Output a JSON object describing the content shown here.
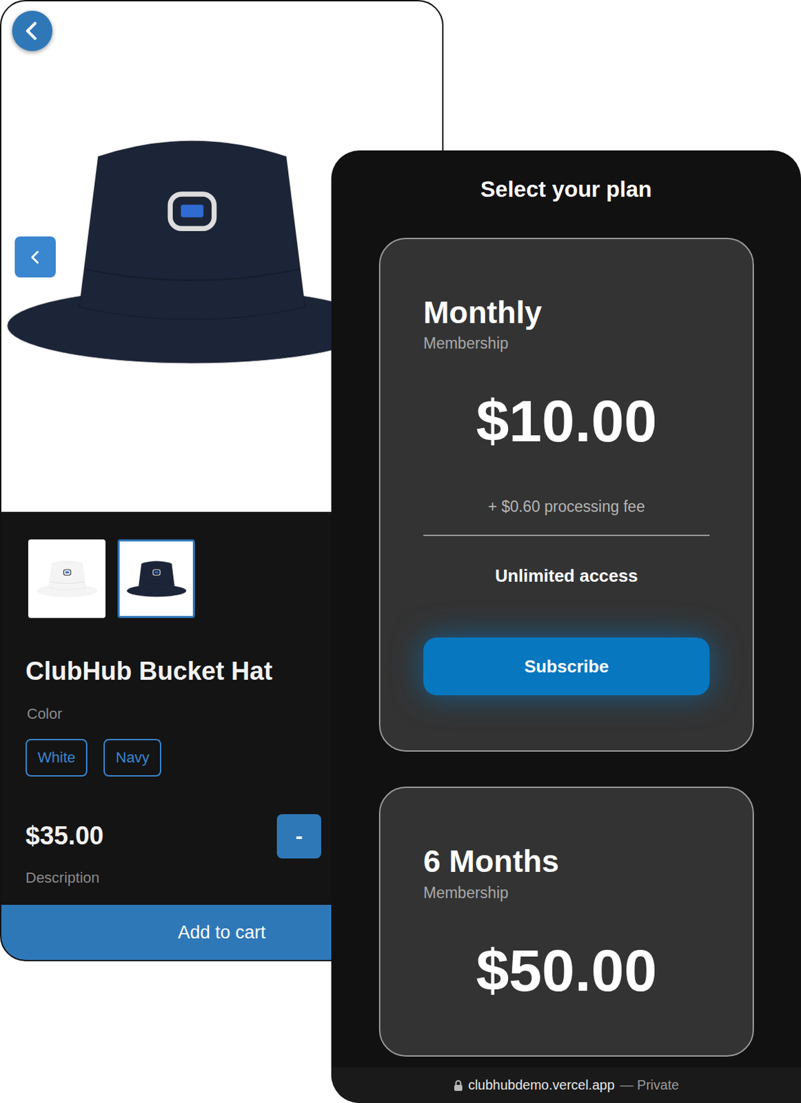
{
  "product": {
    "thumbnails": [
      {
        "color": "#f4f4f4",
        "selected": false
      },
      {
        "color": "#1c2538",
        "selected": true
      }
    ],
    "title": "ClubHub Bucket Hat",
    "color_label": "Color",
    "colors": [
      {
        "label": "White",
        "selected": false
      },
      {
        "label": "Navy",
        "selected": false
      }
    ],
    "price": "$35.00",
    "quantity_button": "-",
    "description_label": "Description",
    "add_to_cart": "Add to cart"
  },
  "plans": {
    "title": "Select your plan",
    "items": [
      {
        "kind": "full",
        "name": "Monthly",
        "subtitle": "Membership",
        "price": "$10.00",
        "fee": "+ $0.60 processing fee",
        "feature": "Unlimited access",
        "button": "Subscribe"
      },
      {
        "kind": "partial",
        "name": "6 Months",
        "subtitle": "Membership",
        "price": "$50.00"
      }
    ]
  },
  "browser_bar": {
    "url": "clubhubdemo.vercel.app",
    "privacy": "— Private"
  }
}
